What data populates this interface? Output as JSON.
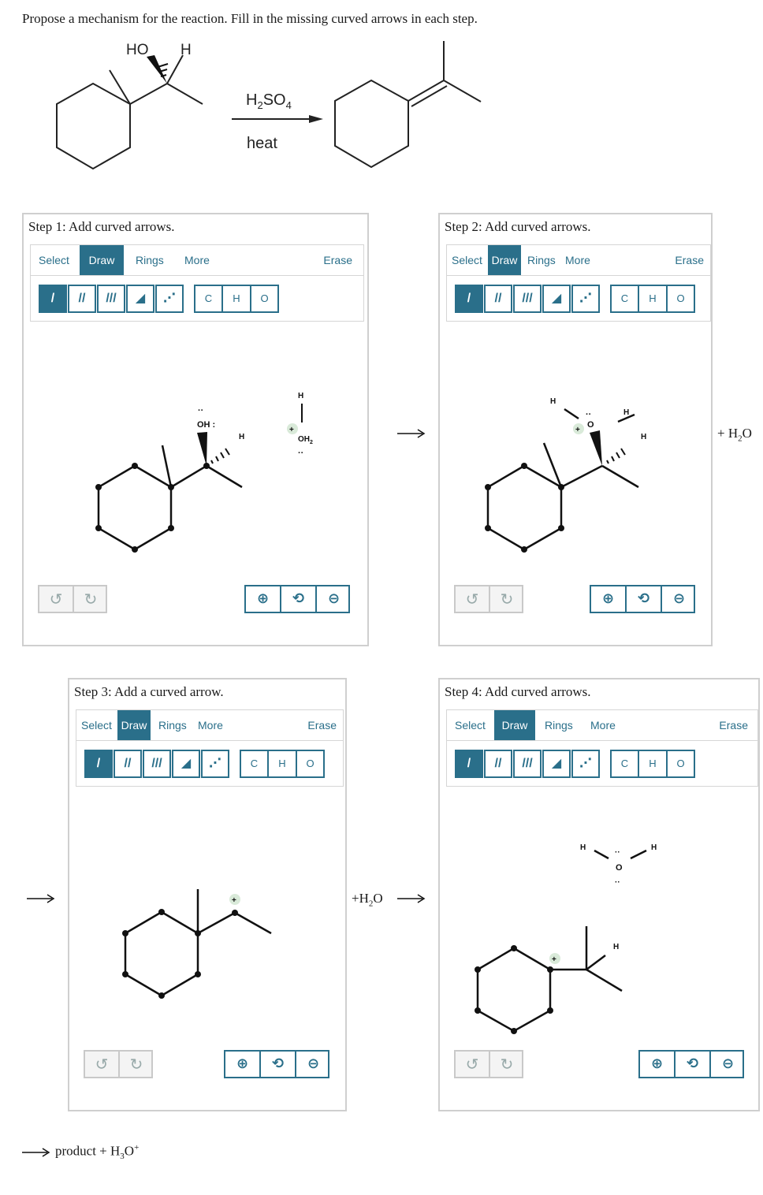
{
  "prompt": "Propose a mechanism for the reaction. Fill in the missing curved arrows in each step.",
  "reaction": {
    "reactant_ho": "HO",
    "reactant_h": "H",
    "reagent": "H2SO4",
    "reagent_main": "H",
    "reagent_sub1": "2",
    "reagent_mid": "SO",
    "reagent_sub2": "4",
    "condition": "heat"
  },
  "toolbar": {
    "select": "Select",
    "draw": "Draw",
    "rings": "Rings",
    "more": "More",
    "erase": "Erase",
    "atoms": [
      "C",
      "H",
      "O"
    ]
  },
  "steps": [
    {
      "title": "Step 1: Add curved arrows."
    },
    {
      "title": "Step 2: Add curved arrows."
    },
    {
      "title": "Step 3: Add a curved arrow."
    },
    {
      "title": "Step 4: Add curved arrows."
    }
  ],
  "labels": {
    "oh_colon": "OH :",
    "oh2": "OH",
    "h": "H",
    "o": "O",
    "plus": "+",
    "plus_h2o_1": "+ H",
    "plus_h2o_2": "+H",
    "h2o_sub": "2",
    "h2o_o": "O",
    "final_product": "product + H",
    "final_sub": "3",
    "final_o": "O",
    "final_sup": "+"
  },
  "colors": {
    "accent": "#2a6f8a",
    "panel_border": "#cfcfcf",
    "charge_bg": "#d9ead9"
  }
}
